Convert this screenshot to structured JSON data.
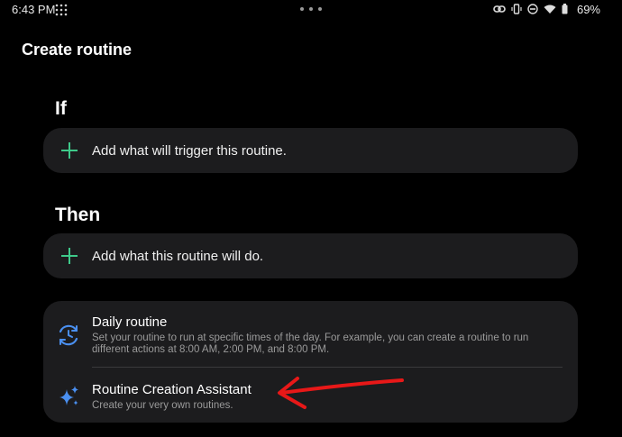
{
  "status_bar": {
    "time": "6:43 PM",
    "battery": "69%"
  },
  "header": {
    "title": "Create routine"
  },
  "if_section": {
    "label": "If",
    "add_text": "Add what will trigger this routine."
  },
  "then_section": {
    "label": "Then",
    "add_text": "Add what this routine will do."
  },
  "options": [
    {
      "title": "Daily routine",
      "description": "Set your routine to run at specific times of the day. For example, you can create a routine to run different actions at 8:00 AM, 2:00 PM, and 8:00 PM.",
      "icon": "clock-cycle-icon"
    },
    {
      "title": "Routine Creation Assistant",
      "description": "Create your very own routines.",
      "icon": "sparkle-icon"
    }
  ],
  "colors": {
    "background": "#000000",
    "card": "#1c1c1e",
    "accent": "#3ec98a",
    "icon_blue": "#4a8ff0",
    "annotation": "#e81818"
  }
}
